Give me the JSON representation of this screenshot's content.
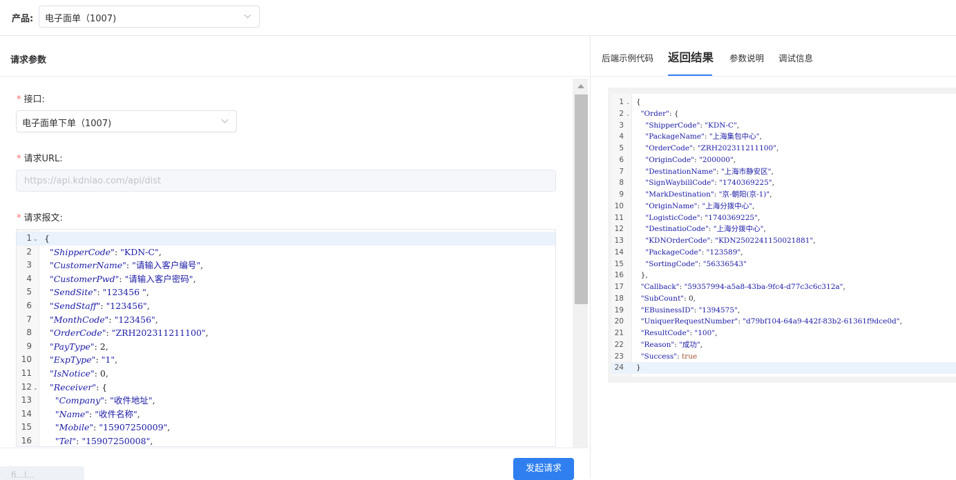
{
  "product": {
    "label": "产品:",
    "value": "电子面单（1007)"
  },
  "left_panel": {
    "title": "请求参数",
    "interface_label": "接口:",
    "interface_value": "电子面单下单（1007)",
    "url_label": "请求URL:",
    "url_placeholder": "https://api.kdniao.com/api/dist",
    "body_label": "请求报文:",
    "find_placeholder": "fi...l...",
    "submit_label": "发起请求"
  },
  "request_code": [
    {
      "n": "1",
      "fold": true,
      "t": "{"
    },
    {
      "n": "2",
      "t": "  \"ShipperCode\": \"KDN-C\","
    },
    {
      "n": "3",
      "t": "  \"CustomerName\": \"请输入客户编号\","
    },
    {
      "n": "4",
      "t": "  \"CustomerPwd\": \"请输入客户密码\","
    },
    {
      "n": "5",
      "t": "  \"SendSite\": \"123456 \","
    },
    {
      "n": "6",
      "t": "  \"SendStaff\": \"123456\","
    },
    {
      "n": "7",
      "t": "  \"MonthCode\": \"123456\","
    },
    {
      "n": "8",
      "t": "  \"OrderCode\": \"ZRH202311211100\","
    },
    {
      "n": "9",
      "t": "  \"PayType\": 2,"
    },
    {
      "n": "10",
      "t": "  \"ExpType\": \"1\","
    },
    {
      "n": "11",
      "t": "  \"IsNotice\": 0,"
    },
    {
      "n": "12",
      "fold": true,
      "t": "  \"Receiver\": {"
    },
    {
      "n": "13",
      "t": "    \"Company\": \"收件地址\","
    },
    {
      "n": "14",
      "t": "    \"Name\": \"收件名称\","
    },
    {
      "n": "15",
      "t": "    \"Mobile\": \"15907250009\","
    },
    {
      "n": "16",
      "t": "    \"Tel\": \"15907250008\","
    }
  ],
  "right_panel": {
    "tabs": [
      "后端示例代码",
      "返回结果",
      "参数说明",
      "调试信息"
    ],
    "active_tab": "返回结果"
  },
  "response_code": [
    {
      "n": "1",
      "fold": true,
      "t": "{"
    },
    {
      "n": "2",
      "fold": true,
      "t": "  \"Order\": {"
    },
    {
      "n": "3",
      "t": "    \"ShipperCode\": \"KDN-C\","
    },
    {
      "n": "4",
      "t": "    \"PackageName\": \"上海集包中心\","
    },
    {
      "n": "5",
      "t": "    \"OrderCode\": \"ZRH202311211100\","
    },
    {
      "n": "6",
      "t": "    \"OriginCode\": \"200000\","
    },
    {
      "n": "7",
      "t": "    \"DestinationName\": \"上海市静安区\","
    },
    {
      "n": "8",
      "t": "    \"SignWaybillCode\": \"1740369225\","
    },
    {
      "n": "9",
      "t": "    \"MarkDestination\": \"京-朝阳(京-1)\","
    },
    {
      "n": "10",
      "t": "    \"OriginName\": \"上海分拨中心\","
    },
    {
      "n": "11",
      "t": "    \"LogisticCode\": \"1740369225\","
    },
    {
      "n": "12",
      "t": "    \"DestinatioCode\": \"上海分拨中心\","
    },
    {
      "n": "13",
      "t": "    \"KDNOrderCode\": \"KDN2502241150021881\","
    },
    {
      "n": "14",
      "t": "    \"PackageCode\": \"123589\","
    },
    {
      "n": "15",
      "t": "    \"SortingCode\": \"56336543\""
    },
    {
      "n": "16",
      "t": "  },"
    },
    {
      "n": "17",
      "t": "  \"Callback\": \"59357994-a5a8-43ba-9fc4-d77c3c6c312a\","
    },
    {
      "n": "18",
      "t": "  \"SubCount\": 0,"
    },
    {
      "n": "19",
      "t": "  \"EBusinessID\": \"1394575\","
    },
    {
      "n": "20",
      "t": "  \"UniquerRequestNumber\": \"d79bf104-64a9-442f-83b2-61361f9dce0d\","
    },
    {
      "n": "21",
      "t": "  \"ResultCode\": \"100\","
    },
    {
      "n": "22",
      "t": "  \"Reason\": \"成功\","
    },
    {
      "n": "23",
      "t": "  \"Success\": true"
    },
    {
      "n": "24",
      "t": "}"
    }
  ],
  "colors": {
    "accent": "#2f7ff0",
    "required": "#f56c6c",
    "code_key": "#1a1aa6",
    "code_bool": "#a0522d"
  }
}
